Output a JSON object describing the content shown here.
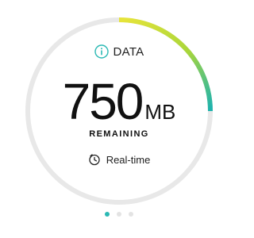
{
  "widget": {
    "label": "DATA",
    "value": "750",
    "unit": "MB",
    "status": "REMAINING",
    "mode_label": "Real-time",
    "remaining_fraction": 0.25
  },
  "colors": {
    "track": "#e8e8e8",
    "gradient_start": "#e6e43a",
    "gradient_mid": "#a9d63a",
    "gradient_end": "#1fb3ad",
    "accent": "#2bb9b4"
  },
  "icons": {
    "info": "info-icon",
    "mode": "clock-icon"
  },
  "pager": {
    "count": 3,
    "active_index": 0
  }
}
